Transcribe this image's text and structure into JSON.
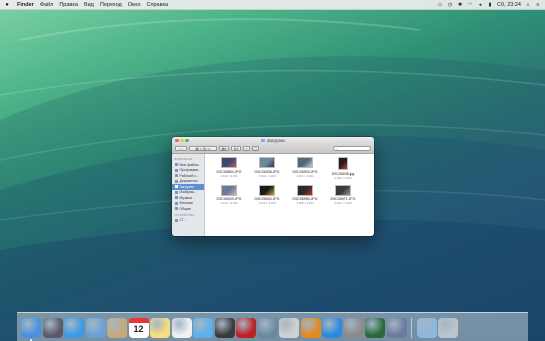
{
  "menubar": {
    "apple": "",
    "items": [
      "Finder",
      "Файл",
      "Правка",
      "Вид",
      "Переход",
      "Окно",
      "Справка"
    ],
    "clock": "Сб, 23:24"
  },
  "finder": {
    "title": "Загрузки",
    "sidebar": {
      "favorites_header": "ИЗБРАННОЕ",
      "items": [
        {
          "label": "Мои файлы"
        },
        {
          "label": "Программы"
        },
        {
          "label": "Рабочий с..."
        },
        {
          "label": "Документы"
        },
        {
          "label": "Загрузки",
          "selected": true
        },
        {
          "label": "Изображ..."
        },
        {
          "label": "Музыка"
        },
        {
          "label": "Фильмы"
        },
        {
          "label": "Общие"
        }
      ],
      "devices_header": "УСТРОЙСТВА",
      "devices": [
        {
          "label": "17..."
        }
      ]
    },
    "files": [
      {
        "name": "DSC06894.JPG",
        "dims": "4 912 × 3 264",
        "colors": [
          "#3a4a6e",
          "#b85a4a"
        ]
      },
      {
        "name": "DSC06936.JPG",
        "dims": "4 912 × 3 264",
        "colors": [
          "#6a8a9e",
          "#2a3a4e"
        ]
      },
      {
        "name": "DSC06933.JPG",
        "dims": "4 912 × 3 264",
        "colors": [
          "#4a6a7e",
          "#c8c8c8"
        ]
      },
      {
        "name": "DSC06938.jpg",
        "dims": "2 184 × 3 264",
        "colors": [
          "#2a1a1a",
          "#d04040"
        ],
        "portrait": true
      },
      {
        "name": "DSC06939.JPG",
        "dims": "4 912 × 3 264",
        "colors": [
          "#6c7a9a",
          "#bbbbbb"
        ]
      },
      {
        "name": "DSC06940.JPG",
        "dims": "4 912 × 3 264",
        "colors": [
          "#1a1a1a",
          "#e0a030"
        ]
      },
      {
        "name": "DSC06950.JPG",
        "dims": "3 488 × 3 264",
        "colors": [
          "#2a2a2a",
          "#c03020"
        ]
      },
      {
        "name": "DSC06971.JPG",
        "dims": "4 912 × 3 264",
        "colors": [
          "#3a3a3a",
          "#9a9a9a"
        ]
      }
    ]
  },
  "dock": {
    "apps": [
      {
        "name": "finder",
        "color": "#4a8fe0",
        "running": true
      },
      {
        "name": "launchpad",
        "color": "#5a5a6a"
      },
      {
        "name": "safari",
        "color": "#3a9ae6"
      },
      {
        "name": "mail",
        "color": "#6aa0d8"
      },
      {
        "name": "contacts",
        "color": "#c8a878"
      },
      {
        "name": "calendar",
        "color": "#ffffff",
        "day": "12"
      },
      {
        "name": "notes",
        "color": "#f5e07a"
      },
      {
        "name": "reminders",
        "color": "#f0f0f0"
      },
      {
        "name": "messages",
        "color": "#5ab0f0"
      },
      {
        "name": "facetime",
        "color": "#3a3a3a"
      },
      {
        "name": "photo-booth",
        "color": "#c02020"
      },
      {
        "name": "iphoto",
        "color": "#6a8aa0"
      },
      {
        "name": "itunes",
        "color": "#d0d0d0"
      },
      {
        "name": "ibooks",
        "color": "#e08a20"
      },
      {
        "name": "app-store",
        "color": "#2a8ae0"
      },
      {
        "name": "system-preferences",
        "color": "#8a8a8a"
      },
      {
        "name": "time-machine",
        "color": "#2a6a3a"
      },
      {
        "name": "boot-camp",
        "color": "#6a7aa0"
      }
    ],
    "extra": [
      {
        "name": "downloads-folder",
        "color": "#8ab8e0"
      },
      {
        "name": "trash",
        "color": "#bcc4cc"
      }
    ]
  }
}
